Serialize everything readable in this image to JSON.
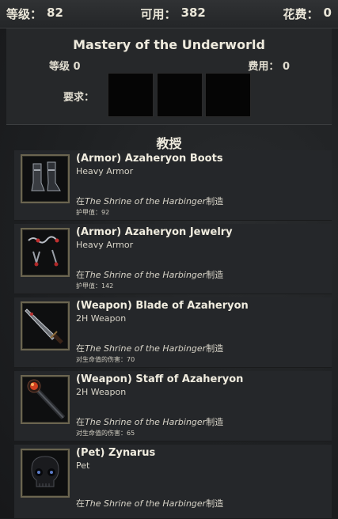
{
  "topbar": {
    "level_label": "等级：",
    "level_value": "82",
    "available_label": "可用：",
    "available_value": "382",
    "spent_label": "花费：",
    "spent_value": "0"
  },
  "mastery": {
    "title": "Mastery of the Underworld",
    "level_label": "等级",
    "level_value": "0",
    "cost_label": "费用：",
    "cost_value": "0",
    "requirements_label": "要求："
  },
  "teaches_heading": "教授",
  "items": [
    {
      "name": "(Armor) Azaheryon Boots",
      "type": "Heavy Armor",
      "made_prefix": "在",
      "made_place": "The Shrine of the Harbinger",
      "made_suffix": "制造",
      "stat": "护甲值：92",
      "icon": "boots-icon"
    },
    {
      "name": "(Armor) Azaheryon Jewelry",
      "type": "Heavy Armor",
      "made_prefix": "在",
      "made_place": "The Shrine of the Harbinger",
      "made_suffix": "制造",
      "stat": "护甲值：142",
      "icon": "jewelry-icon"
    },
    {
      "name": "(Weapon) Blade of Azaheryon",
      "type": "2H Weapon",
      "made_prefix": "在",
      "made_place": "The Shrine of the Harbinger",
      "made_suffix": "制造",
      "stat": "对生命值的伤害：70",
      "icon": "blade-icon"
    },
    {
      "name": "(Weapon) Staff of Azaheryon",
      "type": "2H Weapon",
      "made_prefix": "在",
      "made_place": "The Shrine of the Harbinger",
      "made_suffix": "制造",
      "stat": "对生命值的伤害：65",
      "icon": "staff-icon"
    },
    {
      "name": "(Pet) Zynarus",
      "type": "Pet",
      "made_prefix": "在",
      "made_place": "The Shrine of the Harbinger",
      "made_suffix": "制造",
      "stat": "",
      "icon": "skull-icon"
    }
  ]
}
